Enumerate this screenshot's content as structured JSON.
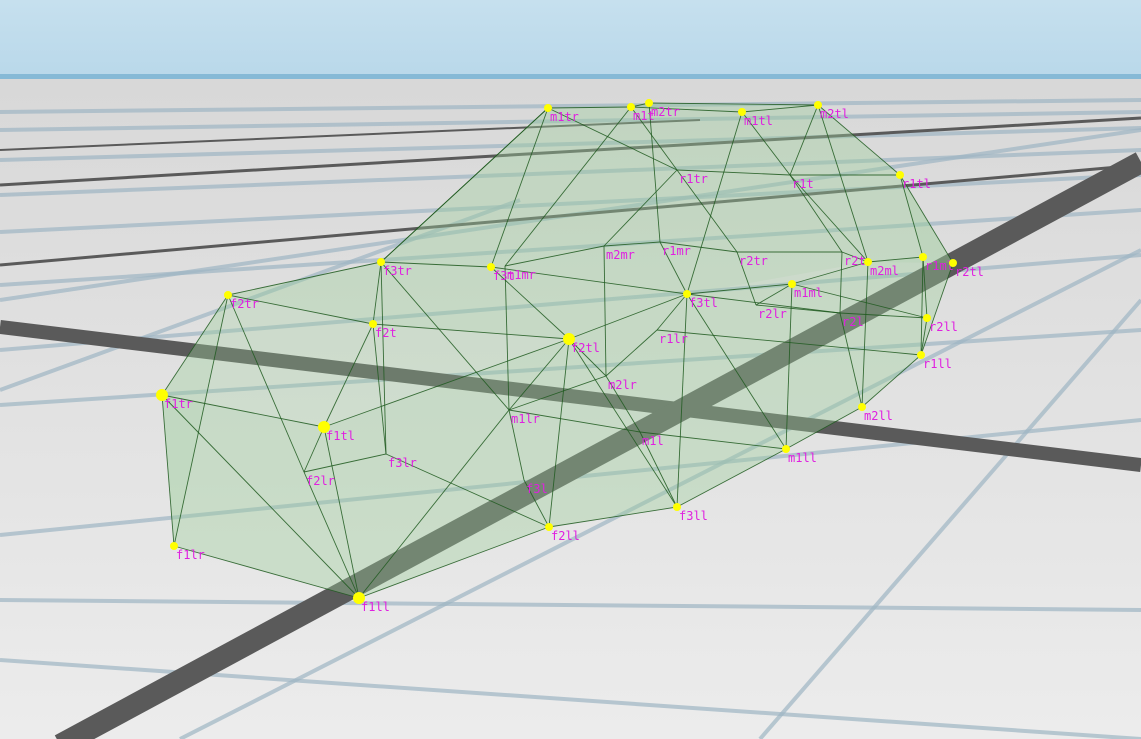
{
  "colors": {
    "sky": "#c3deec",
    "horizon": "#86b9d6",
    "ground": "#e2e2e2",
    "grid_major": "#5a5a5a",
    "grid_minor": "#9fb6c4",
    "hull_fill": "#9fd09a",
    "edge": "#1f5a1f",
    "node": "#ffff00",
    "label": "#e020e0"
  },
  "nodes": [
    {
      "id": "m1tr",
      "label": "m1tr",
      "dot": true
    },
    {
      "id": "m1t",
      "label": "m1t",
      "dot": true
    },
    {
      "id": "m2tr",
      "label": "m2tr",
      "dot": true
    },
    {
      "id": "m1tl",
      "label": "m1tl",
      "dot": true
    },
    {
      "id": "m2tl",
      "label": "m2tl",
      "dot": true
    },
    {
      "id": "r1tr",
      "label": "r1tr",
      "dot": false
    },
    {
      "id": "r1t",
      "label": "r1t",
      "dot": false
    },
    {
      "id": "r1tl",
      "label": "r1tl",
      "dot": true
    },
    {
      "id": "m2mr",
      "label": "m2mr",
      "dot": false
    },
    {
      "id": "r1mr",
      "label": "r1mr",
      "dot": false
    },
    {
      "id": "r2tr",
      "label": "r2tr",
      "dot": false
    },
    {
      "id": "r2t",
      "label": "r2t",
      "dot": false
    },
    {
      "id": "m2ml",
      "label": "m2ml",
      "dot": true
    },
    {
      "id": "r1ml",
      "label": "r1ml",
      "dot": true
    },
    {
      "id": "r2tl",
      "label": "r2tl",
      "dot": true
    },
    {
      "id": "m1mr",
      "label": "m1mr",
      "dot": false
    },
    {
      "id": "f3t",
      "label": "f3t",
      "dot": true
    },
    {
      "id": "f3tr",
      "label": "f3tr",
      "dot": true
    },
    {
      "id": "f2tr",
      "label": "f2tr",
      "dot": true
    },
    {
      "id": "f2t",
      "label": "f2t",
      "dot": true
    },
    {
      "id": "f2tl",
      "label": "f2tl",
      "dot": true
    },
    {
      "id": "f3tl",
      "label": "f3tl",
      "dot": true
    },
    {
      "id": "m1ml",
      "label": "m1ml",
      "dot": true
    },
    {
      "id": "r2lr",
      "label": "r2lr",
      "dot": false
    },
    {
      "id": "r2l",
      "label": "r2l",
      "dot": false
    },
    {
      "id": "r2ll",
      "label": "r2ll",
      "dot": true
    },
    {
      "id": "r1lr",
      "label": "r1lr",
      "dot": false
    },
    {
      "id": "r1ll",
      "label": "r1ll",
      "dot": true
    },
    {
      "id": "m2lr",
      "label": "m2lr",
      "dot": false
    },
    {
      "id": "m2ll",
      "label": "m2ll",
      "dot": true
    },
    {
      "id": "m1lr",
      "label": "m1lr",
      "dot": false
    },
    {
      "id": "m1l",
      "label": "m1l",
      "dot": false
    },
    {
      "id": "m1ll",
      "label": "m1ll",
      "dot": true
    },
    {
      "id": "f1tr",
      "label": "f1tr",
      "dot": true
    },
    {
      "id": "f1tl",
      "label": "f1tl",
      "dot": true
    },
    {
      "id": "f3lr",
      "label": "f3lr",
      "dot": false
    },
    {
      "id": "f2lr",
      "label": "f2lr",
      "dot": false
    },
    {
      "id": "f3l",
      "label": "f3l",
      "dot": false
    },
    {
      "id": "f2ll",
      "label": "f2ll",
      "dot": true
    },
    {
      "id": "f3ll",
      "label": "f3ll",
      "dot": true
    },
    {
      "id": "f1lr",
      "label": "f1lr",
      "dot": true
    },
    {
      "id": "f1ll",
      "label": "f1ll",
      "dot": true
    }
  ],
  "beams": [
    [
      "f1tr",
      "f2tr"
    ],
    [
      "f2tr",
      "f3tr"
    ],
    [
      "f3tr",
      "f3t"
    ],
    [
      "f3t",
      "m1tr"
    ],
    [
      "f3tr",
      "m1tr"
    ],
    [
      "m1tr",
      "m1t"
    ],
    [
      "m1t",
      "m2tr"
    ],
    [
      "m2tr",
      "m2tl"
    ],
    [
      "m1t",
      "m1tl"
    ],
    [
      "m1tl",
      "m2tl"
    ],
    [
      "m2tl",
      "r1tl"
    ],
    [
      "r1tl",
      "r2tl"
    ],
    [
      "r2tl",
      "r1ll"
    ],
    [
      "r1tl",
      "r1ml"
    ],
    [
      "r1ml",
      "r1ll"
    ],
    [
      "r1ll",
      "m2ll"
    ],
    [
      "m2ll",
      "m1ll"
    ],
    [
      "m1ll",
      "f3ll"
    ],
    [
      "f3ll",
      "f2ll"
    ],
    [
      "f2ll",
      "f1ll"
    ],
    [
      "f1ll",
      "f1lr"
    ],
    [
      "f1lr",
      "f1tr"
    ],
    [
      "f1tr",
      "f1tl"
    ],
    [
      "f1tl",
      "f2tl"
    ],
    [
      "f2tl",
      "f3tl"
    ],
    [
      "f3tl",
      "m1ml"
    ],
    [
      "m1ml",
      "m2ml"
    ],
    [
      "m2ml",
      "r1ml"
    ],
    [
      "f2tr",
      "f2t"
    ],
    [
      "f2t",
      "f2tl"
    ],
    [
      "f3tr",
      "f2t"
    ],
    [
      "f2t",
      "f1tl"
    ],
    [
      "f1tl",
      "f1ll"
    ],
    [
      "f1tr",
      "f1ll"
    ],
    [
      "f2tr",
      "f1lr"
    ],
    [
      "f2tr",
      "f2lr"
    ],
    [
      "f2lr",
      "f1ll"
    ],
    [
      "f2lr",
      "f3lr"
    ],
    [
      "f3lr",
      "f2ll"
    ],
    [
      "f3lr",
      "f3tr"
    ],
    [
      "f2tl",
      "f2ll"
    ],
    [
      "f2tl",
      "f3ll"
    ],
    [
      "f2tl",
      "m1lr"
    ],
    [
      "m1lr",
      "f3l"
    ],
    [
      "f3l",
      "f2ll"
    ],
    [
      "m1lr",
      "f1ll"
    ],
    [
      "m1lr",
      "m1mr"
    ],
    [
      "f3tl",
      "f3ll"
    ],
    [
      "f3tl",
      "m1ll"
    ],
    [
      "f3tl",
      "r1lr"
    ],
    [
      "m1l",
      "f3ll"
    ],
    [
      "m1l",
      "m2lr"
    ],
    [
      "m2lr",
      "r1lr"
    ],
    [
      "m2lr",
      "m1lr"
    ],
    [
      "m1ml",
      "m1ll"
    ],
    [
      "m1ml",
      "r2lr"
    ],
    [
      "r2lr",
      "r2l"
    ],
    [
      "r2l",
      "r2ll"
    ],
    [
      "r2l",
      "m2ll"
    ],
    [
      "r2ll",
      "r1ll"
    ],
    [
      "r1lr",
      "r1ll"
    ],
    [
      "m2mr",
      "r1mr"
    ],
    [
      "r1mr",
      "r2tr"
    ],
    [
      "r2tr",
      "r2t"
    ],
    [
      "r2t",
      "m2ml"
    ],
    [
      "m1mr",
      "m2mr"
    ],
    [
      "r1tr",
      "r1t"
    ],
    [
      "r1t",
      "r1tl"
    ],
    [
      "m1tr",
      "r1tr"
    ],
    [
      "m1t",
      "r1tr"
    ],
    [
      "m1tl",
      "r1t"
    ],
    [
      "m2tl",
      "r1t"
    ],
    [
      "r1tr",
      "m2mr"
    ],
    [
      "r1tr",
      "r2tr"
    ],
    [
      "r1t",
      "r2t"
    ],
    [
      "r1t",
      "m2ml"
    ],
    [
      "m1tl",
      "f3tl"
    ],
    [
      "m2tr",
      "r1mr"
    ],
    [
      "m1t",
      "m1mr"
    ],
    [
      "m1tr",
      "f3tr"
    ],
    [
      "m2mr",
      "m2lr"
    ],
    [
      "r1mr",
      "f3tl"
    ],
    [
      "r2tr",
      "r2lr"
    ],
    [
      "r2t",
      "r2l"
    ],
    [
      "m2ml",
      "m2ll"
    ],
    [
      "f3t",
      "f2tl"
    ],
    [
      "f3tr",
      "m1lr"
    ],
    [
      "f2tl",
      "m2lr"
    ],
    [
      "r1ml",
      "r2ll"
    ],
    [
      "m2tl",
      "m2ml"
    ],
    [
      "f2t",
      "f3lr"
    ],
    [
      "f1tl",
      "f2lr"
    ],
    [
      "m1l",
      "m1ll"
    ],
    [
      "m1lr",
      "m1l"
    ],
    [
      "f3t",
      "f3tl"
    ],
    [
      "f3tl",
      "r2l"
    ],
    [
      "m1ml",
      "r2ll"
    ]
  ]
}
